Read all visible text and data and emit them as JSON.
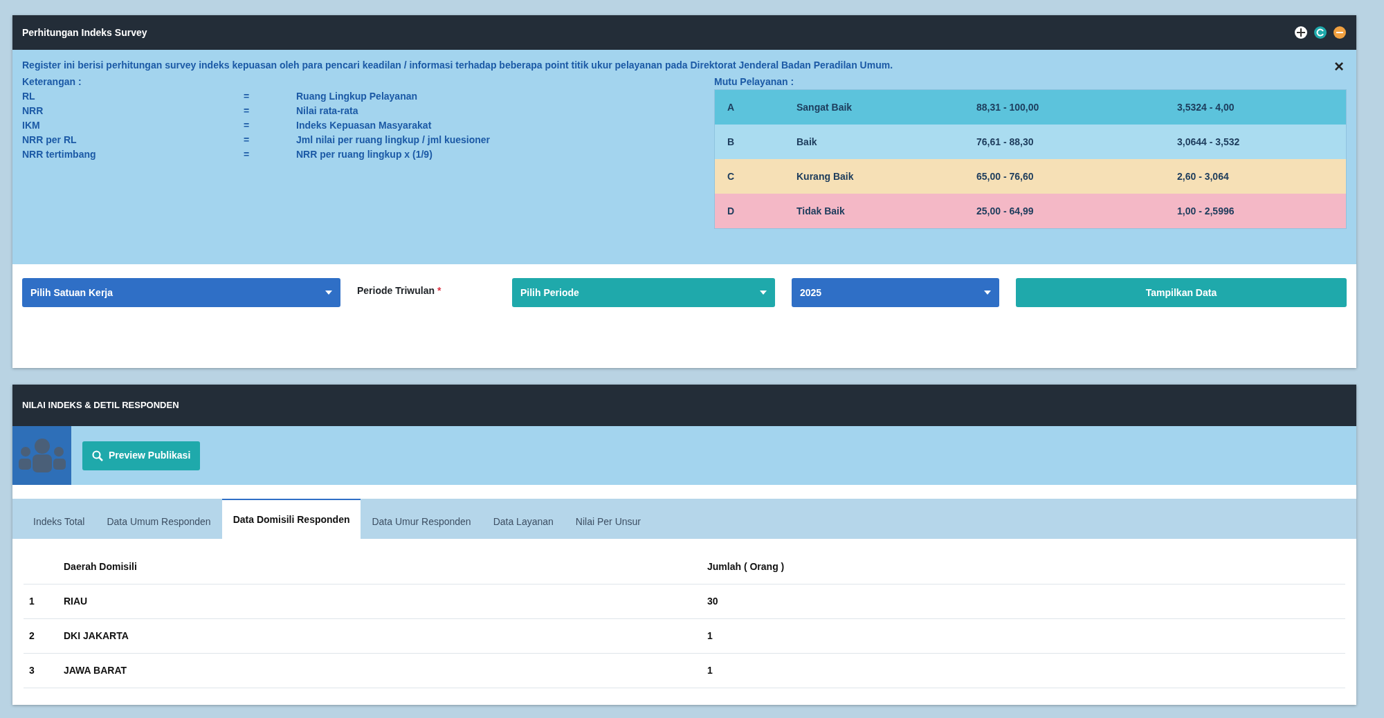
{
  "panel": {
    "title": "Perhitungan Indeks Survey",
    "intro": "Register ini berisi perhitungan survey indeks kepuasan oleh para pencari keadilan / informasi terhadap beberapa point titik ukur pelayanan pada Direktorat Jenderal Badan Peradilan Umum.",
    "legend_title": "Keterangan :",
    "legend": [
      {
        "term": "RL",
        "sep": "=",
        "meaning": "Ruang Lingkup Pelayanan"
      },
      {
        "term": "NRR",
        "sep": "=",
        "meaning": "Nilai rata-rata"
      },
      {
        "term": "IKM",
        "sep": "=",
        "meaning": "Indeks Kepuasan Masyarakat"
      },
      {
        "term": "NRR per RL",
        "sep": "=",
        "meaning": "Jml nilai per ruang lingkup / jml kuesioner"
      },
      {
        "term": "NRR tertimbang",
        "sep": "=",
        "meaning": "NRR per ruang lingkup x (1/9)"
      }
    ],
    "close": "×",
    "grades_title": "Mutu Pelayanan :",
    "grades": [
      {
        "grade": "A",
        "label": "Sangat Baik",
        "range": "88,31 - 100,00",
        "score": "3,5324 - 4,00",
        "color": "#5cc3dc"
      },
      {
        "grade": "B",
        "label": "Baik",
        "range": "76,61 - 88,30",
        "score": "3,0644 - 3,532",
        "color": "#aadcf0"
      },
      {
        "grade": "C",
        "label": "Kurang Baik",
        "range": "65,00 - 76,60",
        "score": "2,60 - 3,064",
        "color": "#f6e0b6"
      },
      {
        "grade": "D",
        "label": "Tidak Baik",
        "range": "25,00 - 64,99",
        "score": "1,00 - 2,5996",
        "color": "#f4b8c6"
      }
    ]
  },
  "filters": {
    "unit": "Pilih Satuan Kerja",
    "period_label": "Periode Triwulan",
    "required": "*",
    "period": "Pilih Periode",
    "year": "2025",
    "submit": "Tampilkan Data"
  },
  "results": {
    "title": "NILAI INDEKS & DETIL RESPONDEN",
    "preview": "Preview Publikasi",
    "tabs": [
      {
        "label": "Indeks Total",
        "selected": false
      },
      {
        "label": "Data Umum Responden",
        "selected": false
      },
      {
        "label": "Data Domisili Responden",
        "selected": true
      },
      {
        "label": "Data Umur Responden",
        "selected": false
      },
      {
        "label": "Data Layanan",
        "selected": false
      },
      {
        "label": "Nilai Per Unsur",
        "selected": false
      }
    ],
    "table": {
      "columns": [
        "Daerah Domisili",
        "Jumlah ( Orang )"
      ],
      "rows": [
        {
          "no": "1",
          "region": "RIAU",
          "count": "30"
        },
        {
          "no": "2",
          "region": "DKI JAKARTA",
          "count": "1"
        },
        {
          "no": "3",
          "region": "JAWA BARAT",
          "count": "1"
        }
      ]
    }
  }
}
